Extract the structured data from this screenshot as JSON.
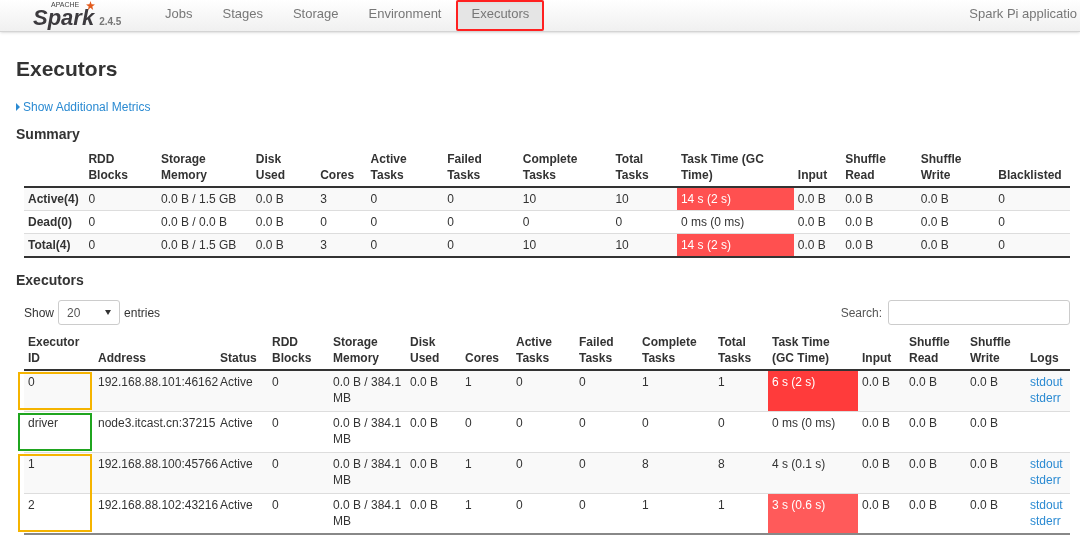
{
  "nav": {
    "logo_top": "APACHE",
    "logo": "Spark",
    "version": "2.4.5",
    "tabs": [
      {
        "label": "Jobs",
        "selected": false,
        "annotated": false
      },
      {
        "label": "Stages",
        "selected": false,
        "annotated": false
      },
      {
        "label": "Storage",
        "selected": false,
        "annotated": false
      },
      {
        "label": "Environment",
        "selected": false,
        "annotated": false
      },
      {
        "label": "Executors",
        "selected": true,
        "annotated": true
      }
    ],
    "app_name": "Spark Pi applicatio"
  },
  "page_title": "Executors",
  "metrics_toggle": {
    "label": "Show Additional Metrics",
    "expanded": false
  },
  "summary": {
    "title": "Summary",
    "columns": [
      {
        "label": "RDD Blocks",
        "kind": "plain"
      },
      {
        "label": "Storage Memory",
        "kind": "plain"
      },
      {
        "label": "Disk Used",
        "kind": "plain"
      },
      {
        "label": "Cores",
        "kind": "plain"
      },
      {
        "label": "Active Tasks",
        "kind": "plain"
      },
      {
        "label": "Failed Tasks",
        "kind": "plain"
      },
      {
        "label": "Complete Tasks",
        "kind": "plain"
      },
      {
        "label": "Total Tasks",
        "kind": "plain"
      },
      {
        "label": "Task Time (GC Time)",
        "kind": "task_time"
      },
      {
        "label": "Input",
        "kind": "plain"
      },
      {
        "label": "Shuffle Read",
        "kind": "plain"
      },
      {
        "label": "Shuffle Write",
        "kind": "plain"
      },
      {
        "label": "Blacklisted",
        "kind": "plain"
      }
    ],
    "rows": [
      {
        "label": "Active(4)",
        "cells": [
          "0",
          "0.0 B / 1.5 GB",
          "0.0 B",
          "3",
          "0",
          "0",
          "10",
          "10",
          {
            "text": "14 s (2 s)",
            "color": "#ff5050"
          },
          "0.0 B",
          "0.0 B",
          "0.0 B",
          "0"
        ]
      },
      {
        "label": "Dead(0)",
        "cells": [
          "0",
          "0.0 B / 0.0 B",
          "0.0 B",
          "0",
          "0",
          "0",
          "0",
          "0",
          {
            "text": "0 ms (0 ms)"
          },
          "0.0 B",
          "0.0 B",
          "0.0 B",
          "0"
        ]
      },
      {
        "label": "Total(4)",
        "cells": [
          "0",
          "0.0 B / 1.5 GB",
          "0.0 B",
          "3",
          "0",
          "0",
          "10",
          "10",
          {
            "text": "14 s (2 s)",
            "color": "#ff5050"
          },
          "0.0 B",
          "0.0 B",
          "0.0 B",
          "0"
        ]
      }
    ]
  },
  "executors": {
    "title": "Executors",
    "show_label": "Show",
    "page_size": "20",
    "entries_label": "entries",
    "search_label": "Search:",
    "columns": [
      {
        "label": "Executor ID",
        "kind": "plain"
      },
      {
        "label": "Address",
        "kind": "plain"
      },
      {
        "label": "Status",
        "kind": "plain"
      },
      {
        "label": "RDD Blocks",
        "kind": "plain"
      },
      {
        "label": "Storage Memory",
        "kind": "plain"
      },
      {
        "label": "Disk Used",
        "kind": "plain"
      },
      {
        "label": "Cores",
        "kind": "plain"
      },
      {
        "label": "Active Tasks",
        "kind": "plain"
      },
      {
        "label": "Failed Tasks",
        "kind": "plain"
      },
      {
        "label": "Complete Tasks",
        "kind": "plain"
      },
      {
        "label": "Total Tasks",
        "kind": "plain"
      },
      {
        "label": "Task Time (GC Time)",
        "kind": "task_time"
      },
      {
        "label": "Input",
        "kind": "plain"
      },
      {
        "label": "Shuffle Read",
        "kind": "plain"
      },
      {
        "label": "Shuffle Write",
        "kind": "plain"
      },
      {
        "label": "Logs",
        "kind": "logs"
      }
    ],
    "rows": [
      {
        "marker": {
          "color": "#f5b400"
        },
        "cells": [
          "0",
          "192.168.88.101:46162",
          "Active",
          "0",
          "0.0 B / 384.1 MB",
          "0.0 B",
          "1",
          "0",
          "0",
          "1",
          "1",
          {
            "text": "6 s (2 s)",
            "color": "#ff3b3b"
          },
          "0.0 B",
          "0.0 B",
          "0.0 B",
          [
            "stdout",
            "stderr"
          ]
        ]
      },
      {
        "marker": {
          "color": "#1fa51f"
        },
        "cells": [
          "driver",
          "node3.itcast.cn:37215",
          "Active",
          "0",
          "0.0 B / 384.1 MB",
          "0.0 B",
          "0",
          "0",
          "0",
          "0",
          "0",
          {
            "text": "0 ms (0 ms)"
          },
          "0.0 B",
          "0.0 B",
          "0.0 B",
          []
        ]
      },
      {
        "marker": {
          "color": "#f5b400"
        },
        "cells": [
          "1",
          "192.168.88.100:45766",
          "Active",
          "0",
          "0.0 B / 384.1 MB",
          "0.0 B",
          "1",
          "0",
          "0",
          "8",
          "8",
          {
            "text": "4 s (0.1 s)"
          },
          "0.0 B",
          "0.0 B",
          "0.0 B",
          [
            "stdout",
            "stderr"
          ]
        ]
      },
      {
        "marker": {
          "color": "#f5b400"
        },
        "cells": [
          "2",
          "192.168.88.102:43216",
          "Active",
          "0",
          "0.0 B / 384.1 MB",
          "0.0 B",
          "1",
          "0",
          "0",
          "1",
          "1",
          {
            "text": "3 s (0.6 s)",
            "color": "#ff5a5a"
          },
          "0.0 B",
          "0.0 B",
          "0.0 B",
          [
            "stdout",
            "stderr"
          ]
        ]
      }
    ]
  }
}
